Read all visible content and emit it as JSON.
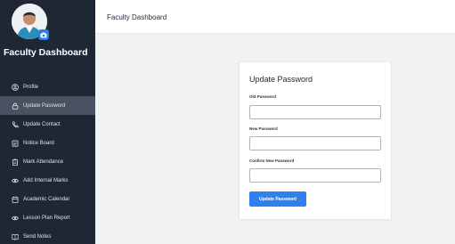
{
  "header": {
    "title": "Faculty Dashboard"
  },
  "sidebar": {
    "title": "Faculty Dashboard",
    "items": [
      {
        "label": "Profile",
        "icon": "user-circle-icon",
        "active": false
      },
      {
        "label": "Update Password",
        "icon": "lock-icon",
        "active": true
      },
      {
        "label": "Update Contact",
        "icon": "phone-icon",
        "active": false
      },
      {
        "label": "Notice Board",
        "icon": "notice-board-icon",
        "active": false
      },
      {
        "label": "Mark Attendance",
        "icon": "clipboard-icon",
        "active": false
      },
      {
        "label": "Add Internal Marks",
        "icon": "eye-icon",
        "active": false
      },
      {
        "label": "Academic Calendar",
        "icon": "calendar-icon",
        "active": false
      },
      {
        "label": "Lesson Plan Report",
        "icon": "eye-icon",
        "active": false
      },
      {
        "label": "Send Notes",
        "icon": "book-icon",
        "active": false
      }
    ]
  },
  "form": {
    "title": "Update Password",
    "old_password_label": "Old Password",
    "new_password_label": "New Password",
    "confirm_password_label": "Confirm New Password",
    "submit_label": "Update Password"
  },
  "colors": {
    "sidebar_bg": "#1f2734",
    "sidebar_active": "#4a5160",
    "accent": "#2f80ed",
    "page_bg": "#f1f2f4"
  }
}
